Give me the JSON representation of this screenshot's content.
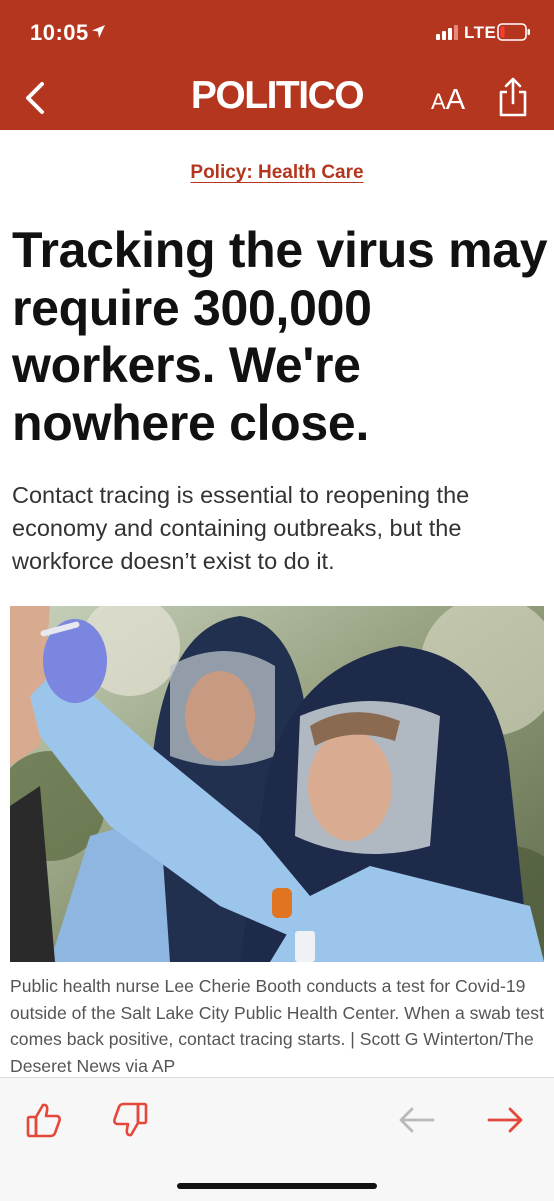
{
  "status_bar": {
    "time": "10:05",
    "network": "LTE"
  },
  "nav": {
    "brand": "POLITICO",
    "text_size_small": "A",
    "text_size_large": "A"
  },
  "article": {
    "section": "Policy: Health Care",
    "headline": "Tracking the virus may require 300,000 workers. We're nowhere close.",
    "dek": "Contact tracing is essential to reopening the economy and containing outbreaks, but the workforce doesn’t exist to do it.",
    "caption": "Public health nurse Lee Cherie Booth conducts a test for Covid-19 outside of the Salt Lake City Public Health Center. When a swab test comes back positive, contact tracing starts. | Scott G Winterton/The Deseret News via AP"
  },
  "colors": {
    "brand_red": "#b5361f",
    "toolbar_icon_red": "#e5473b",
    "disabled_gray": "#b9b9b9"
  },
  "icons": {
    "back": "chevron-left-icon",
    "share": "share-icon",
    "like": "thumbs-up-icon",
    "dislike": "thumbs-down-icon",
    "previous": "arrow-left-icon",
    "next": "arrow-right-icon"
  },
  "toolbar": {
    "previous_enabled": false,
    "next_enabled": true
  }
}
